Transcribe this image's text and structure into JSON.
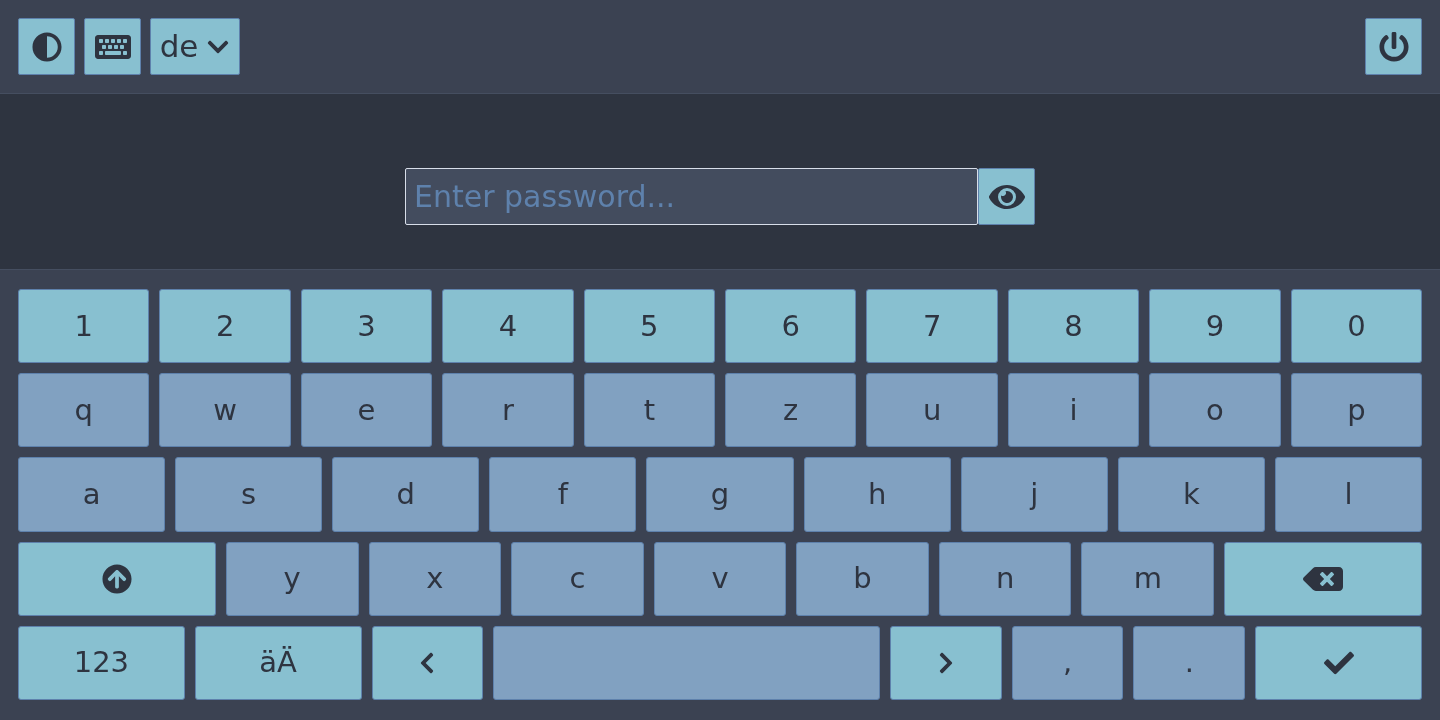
{
  "toolbar": {
    "left": [
      {
        "kind": "contrast"
      },
      {
        "kind": "keyboard"
      },
      {
        "kind": "language",
        "label": "de"
      }
    ],
    "right": [
      {
        "kind": "power"
      }
    ]
  },
  "password": {
    "placeholder": "Enter password..."
  },
  "keyboard": {
    "rows": [
      [
        {
          "kind": "digit",
          "label": "1"
        },
        {
          "kind": "digit",
          "label": "2"
        },
        {
          "kind": "digit",
          "label": "3"
        },
        {
          "kind": "digit",
          "label": "4"
        },
        {
          "kind": "digit",
          "label": "5"
        },
        {
          "kind": "digit",
          "label": "6"
        },
        {
          "kind": "digit",
          "label": "7"
        },
        {
          "kind": "digit",
          "label": "8"
        },
        {
          "kind": "digit",
          "label": "9"
        },
        {
          "kind": "digit",
          "label": "0"
        }
      ],
      [
        {
          "kind": "letter",
          "label": "q"
        },
        {
          "kind": "letter",
          "label": "w"
        },
        {
          "kind": "letter",
          "label": "e"
        },
        {
          "kind": "letter",
          "label": "r"
        },
        {
          "kind": "letter",
          "label": "t"
        },
        {
          "kind": "letter",
          "label": "z"
        },
        {
          "kind": "letter",
          "label": "u"
        },
        {
          "kind": "letter",
          "label": "i"
        },
        {
          "kind": "letter",
          "label": "o"
        },
        {
          "kind": "letter",
          "label": "p"
        }
      ],
      [
        {
          "kind": "letter",
          "label": "a"
        },
        {
          "kind": "letter",
          "label": "s"
        },
        {
          "kind": "letter",
          "label": "d"
        },
        {
          "kind": "letter",
          "label": "f"
        },
        {
          "kind": "letter",
          "label": "g"
        },
        {
          "kind": "letter",
          "label": "h"
        },
        {
          "kind": "letter",
          "label": "j"
        },
        {
          "kind": "letter",
          "label": "k"
        },
        {
          "kind": "letter",
          "label": "l"
        }
      ],
      [
        {
          "kind": "shift"
        },
        {
          "kind": "letter",
          "label": "y"
        },
        {
          "kind": "letter",
          "label": "x"
        },
        {
          "kind": "letter",
          "label": "c"
        },
        {
          "kind": "letter",
          "label": "v"
        },
        {
          "kind": "letter",
          "label": "b"
        },
        {
          "kind": "letter",
          "label": "n"
        },
        {
          "kind": "letter",
          "label": "m"
        },
        {
          "kind": "backspace"
        }
      ],
      [
        {
          "kind": "mode",
          "label": "123"
        },
        {
          "kind": "mode",
          "label": "äÄ"
        },
        {
          "kind": "left"
        },
        {
          "kind": "space"
        },
        {
          "kind": "right"
        },
        {
          "kind": "symbol",
          "label": ","
        },
        {
          "kind": "symbol",
          "label": "."
        },
        {
          "kind": "enter"
        }
      ]
    ]
  }
}
